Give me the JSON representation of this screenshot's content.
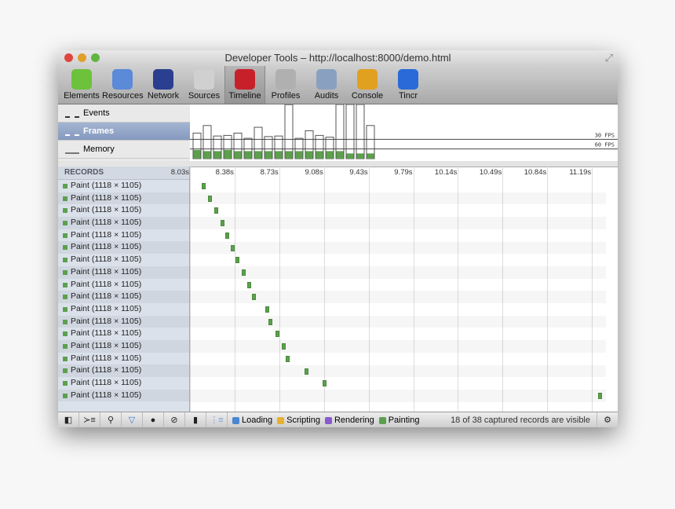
{
  "window": {
    "title": "Developer Tools – http://localhost:8000/demo.html"
  },
  "toolbar": [
    {
      "label": "Elements",
      "icon": "elements-icon",
      "color": "#6cc23a"
    },
    {
      "label": "Resources",
      "icon": "resources-icon",
      "color": "#5a8ad8"
    },
    {
      "label": "Network",
      "icon": "network-icon",
      "color": "#2a3f8f"
    },
    {
      "label": "Sources",
      "icon": "sources-icon",
      "color": "#d0d0d0"
    },
    {
      "label": "Timeline",
      "icon": "timeline-icon",
      "color": "#c8202a",
      "selected": true
    },
    {
      "label": "Profiles",
      "icon": "profiles-icon",
      "color": "#b0b0b0"
    },
    {
      "label": "Audits",
      "icon": "audits-icon",
      "color": "#8aa0c0"
    },
    {
      "label": "Console",
      "icon": "console-icon",
      "color": "#e0a020"
    },
    {
      "label": "Tincr",
      "icon": "tincr-icon",
      "color": "#2a6ad8"
    }
  ],
  "overview": {
    "items": [
      {
        "label": "Events"
      },
      {
        "label": "Frames",
        "selected": true
      },
      {
        "label": "Memory"
      }
    ],
    "fps_lines": [
      "30 FPS",
      "60 FPS"
    ]
  },
  "chart_data": {
    "type": "bar",
    "title": "",
    "units": "ms",
    "frame_times": [
      44,
      57,
      39,
      40,
      44,
      35,
      54,
      38,
      39,
      93,
      35,
      48,
      40,
      37,
      110,
      110,
      110,
      57
    ],
    "painting_times": [
      15,
      13,
      13,
      15,
      13,
      13,
      13,
      13,
      13,
      13,
      13,
      13,
      13,
      13,
      13,
      9,
      9,
      9
    ]
  },
  "records": {
    "header": "RECORDS",
    "ticks": [
      "8.03s",
      "8.38s",
      "8.73s",
      "9.08s",
      "9.43s",
      "9.79s",
      "10.14s",
      "10.49s",
      "10.84s",
      "11.19s"
    ],
    "range": [
      8.03,
      11.3
    ],
    "items": [
      {
        "label": "Paint (1118 × 1105)",
        "t": 8.12
      },
      {
        "label": "Paint (1118 × 1105)",
        "t": 8.17
      },
      {
        "label": "Paint (1118 × 1105)",
        "t": 8.22
      },
      {
        "label": "Paint (1118 × 1105)",
        "t": 8.27
      },
      {
        "label": "Paint (1118 × 1105)",
        "t": 8.31
      },
      {
        "label": "Paint (1118 × 1105)",
        "t": 8.35
      },
      {
        "label": "Paint (1118 × 1105)",
        "t": 8.39
      },
      {
        "label": "Paint (1118 × 1105)",
        "t": 8.44
      },
      {
        "label": "Paint (1118 × 1105)",
        "t": 8.48
      },
      {
        "label": "Paint (1118 × 1105)",
        "t": 8.52
      },
      {
        "label": "Paint (1118 × 1105)",
        "t": 8.62
      },
      {
        "label": "Paint (1118 × 1105)",
        "t": 8.65
      },
      {
        "label": "Paint (1118 × 1105)",
        "t": 8.7
      },
      {
        "label": "Paint (1118 × 1105)",
        "t": 8.75
      },
      {
        "label": "Paint (1118 × 1105)",
        "t": 8.78
      },
      {
        "label": "Paint (1118 × 1105)",
        "t": 8.93
      },
      {
        "label": "Paint (1118 × 1105)",
        "t": 9.07
      },
      {
        "label": "Paint (1118 × 1105)",
        "t": 11.24
      }
    ]
  },
  "status": {
    "filters": [
      {
        "label": "Loading",
        "color": "#4a86d0",
        "checked": true
      },
      {
        "label": "Scripting",
        "color": "#e8b030",
        "checked": true
      },
      {
        "label": "Rendering",
        "color": "#8a5ad0",
        "checked": true
      },
      {
        "label": "Painting",
        "color": "#5ca04d",
        "checked": true
      }
    ],
    "summary": "18 of 38 captured records are visible"
  }
}
